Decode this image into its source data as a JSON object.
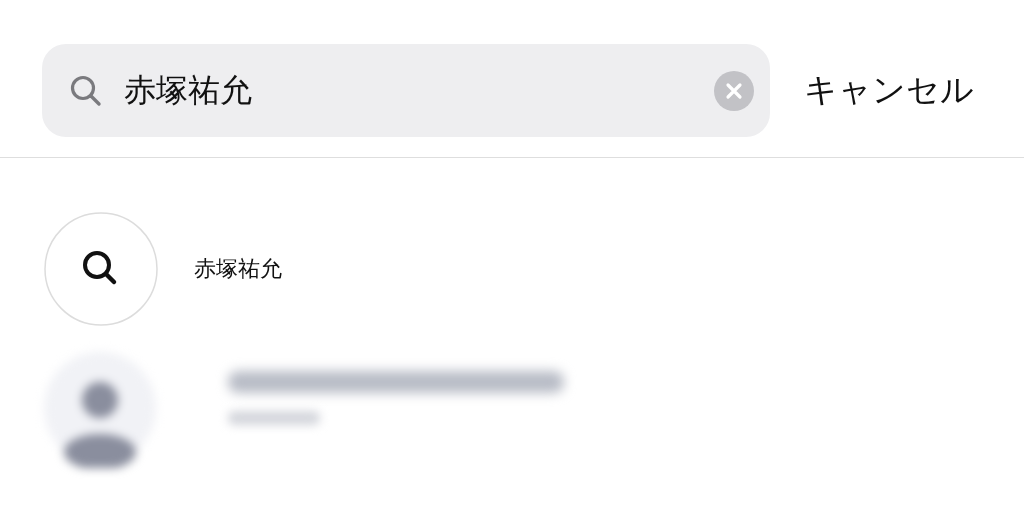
{
  "search": {
    "value": "赤塚祐允",
    "cancel": "キャンセル"
  },
  "results": [
    {
      "kind": "query",
      "text": "赤塚祐允"
    },
    {
      "kind": "account"
    }
  ]
}
